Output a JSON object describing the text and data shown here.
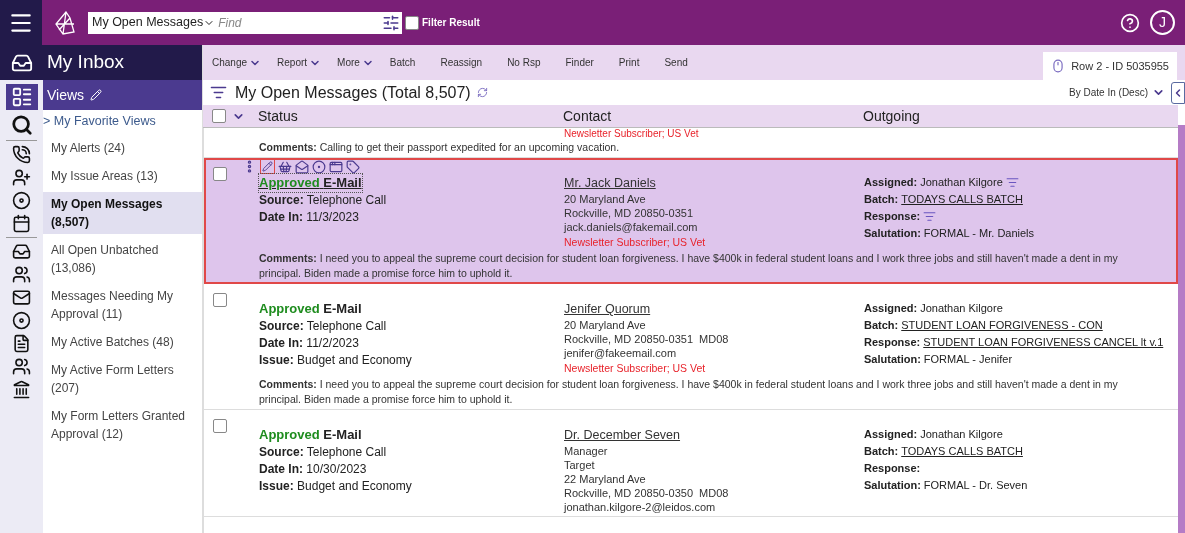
{
  "topbar": {
    "view_select": "My Open Messages",
    "search_placeholder": "Find",
    "filter_result": {
      "label": "Filter Result",
      "checked": false
    },
    "avatar": "J"
  },
  "sidebar": {
    "title": "My Inbox",
    "views_label": "Views",
    "favorite_link": "> My Favorite Views",
    "items": [
      {
        "label": "My Alerts (24)",
        "selected": false
      },
      {
        "label": "My Issue Areas (13)",
        "selected": false
      },
      {
        "label": "My Open Messages (8,507)",
        "selected": true
      },
      {
        "label": "All Open Unbatched (13,086)",
        "selected": false
      },
      {
        "label": "Messages Needing My Approval (11)",
        "selected": false
      },
      {
        "label": "My Active Batches (48)",
        "selected": false
      },
      {
        "label": "My Active Form Letters (207)",
        "selected": false
      },
      {
        "label": "My Form Letters Granted Approval (12)",
        "selected": false
      }
    ]
  },
  "toolbar": [
    {
      "label": "Change",
      "dropdown": true
    },
    {
      "label": "Report",
      "dropdown": true
    },
    {
      "label": "More",
      "dropdown": true
    },
    {
      "label": "Batch",
      "dropdown": false
    },
    {
      "label": "Reassign",
      "dropdown": false
    },
    {
      "label": "No Rsp",
      "dropdown": false
    },
    {
      "label": "Finder",
      "dropdown": false
    },
    {
      "label": "Print",
      "dropdown": false
    },
    {
      "label": "Send",
      "dropdown": false
    }
  ],
  "row_indicator": "Row 2 - ID 5035955",
  "list_title": "My Open Messages (Total 8,507)",
  "sort": "By Date In (Desc)",
  "select_all": {
    "checked": false
  },
  "columns": [
    "Status",
    "Contact",
    "Outgoing"
  ],
  "top_fragment": {
    "contact_tags": "Newsletter Subscriber; US Vet",
    "comments_label": "Comments:",
    "comments": "Calling to get their passport expedited for an upcoming vacation."
  },
  "rows": [
    {
      "selected": true,
      "checked": false,
      "status": "Approved",
      "type": "E-Mail",
      "details": [
        {
          "label": "Source:",
          "value": "Telephone Call"
        },
        {
          "label": "Date In:",
          "value": "11/3/2023"
        }
      ],
      "contact": {
        "name": "Mr. Jack Daniels",
        "lines": [
          "20 Maryland Ave",
          "Rockville, MD 20850-0351",
          "jack.daniels@fakemail.com"
        ],
        "tags": "Newsletter Subscriber; US Vet"
      },
      "outgoing": [
        {
          "label": "Assigned:",
          "value": "Jonathan Kilgore",
          "link": false,
          "filter": true
        },
        {
          "label": "Batch:",
          "value": "TODAYS CALLS BATCH",
          "link": true,
          "filter": false
        },
        {
          "label": "Response:",
          "filter": true
        },
        {
          "label": "Salutation:",
          "value": "FORMAL - Mr. Daniels",
          "link": false,
          "filter": false
        }
      ],
      "comments_label": "Comments:",
      "comments": "I need you to appeal the supreme court decision for student loan forgiveness. I have $400k in federal student loans and I work three jobs and still haven't made a dent in my principal. Biden made a promise force him to uphold it."
    },
    {
      "selected": false,
      "checked": false,
      "status": "Approved",
      "type": "E-Mail",
      "details": [
        {
          "label": "Source:",
          "value": "Telephone Call"
        },
        {
          "label": "Date In:",
          "value": "11/2/2023"
        },
        {
          "label": "Issue:",
          "value": "Budget and Economy"
        }
      ],
      "contact": {
        "name": "Jenifer Quorum",
        "lines": [
          "20 Maryland Ave",
          "Rockville, MD 20850-0351  MD08",
          "jenifer@fakeemail.com"
        ],
        "tags": "Newsletter Subscriber; US Vet"
      },
      "outgoing": [
        {
          "label": "Assigned:",
          "value": "Jonathan Kilgore",
          "link": false,
          "filter": false
        },
        {
          "label": "Batch:",
          "value": "STUDENT LOAN FORGIVENESS - CON",
          "link": true,
          "filter": false
        },
        {
          "label": "Response:",
          "value": "STUDENT LOAN FORGIVENESS CANCEL lt v.1",
          "link": true,
          "filter": false
        },
        {
          "label": "Salutation:",
          "value": "FORMAL - Jenifer",
          "link": false,
          "filter": false
        }
      ],
      "comments_label": "Comments:",
      "comments": "I need you to appeal the supreme court decision for student loan forgiveness. I have $400k in federal student loans and I work three jobs and still haven't made a dent in my principal. Biden made a promise force him to uphold it."
    },
    {
      "selected": false,
      "checked": false,
      "status": "Approved",
      "type": "E-Mail",
      "details": [
        {
          "label": "Source:",
          "value": "Telephone Call"
        },
        {
          "label": "Date In:",
          "value": "10/30/2023"
        },
        {
          "label": "Issue:",
          "value": "Budget and Economy"
        }
      ],
      "contact": {
        "name": "Dr. December Seven",
        "lines": [
          "Manager",
          "Target",
          "22 Maryland Ave",
          "Rockville, MD 20850-0350  MD08",
          "jonathan.kilgore-2@leidos.com"
        ]
      },
      "outgoing": [
        {
          "label": "Assigned:",
          "value": "Jonathan Kilgore",
          "link": false,
          "filter": false
        },
        {
          "label": "Batch:",
          "value": "TODAYS CALLS BATCH",
          "link": true,
          "filter": false
        },
        {
          "label": "Response:",
          "filter": false
        },
        {
          "label": "Salutation:",
          "value": "FORMAL - Dr. Seven",
          "link": false,
          "filter": false
        }
      ]
    }
  ]
}
